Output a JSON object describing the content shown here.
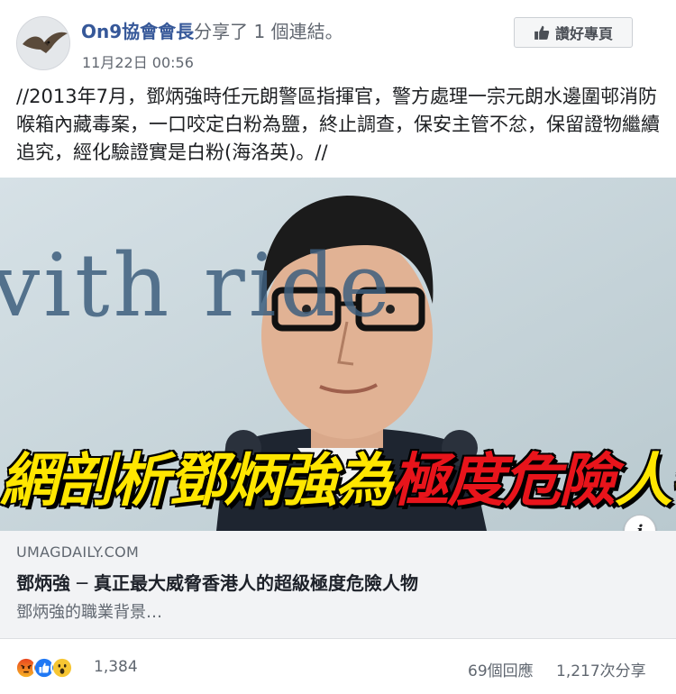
{
  "post": {
    "author": {
      "page_name": "On9協會會長",
      "shared_text": "分享了 1 個連結。",
      "timestamp": "11月22日 00:56",
      "avatar_icon": "bird-icon"
    },
    "like_page_button": {
      "label": "讚好專頁",
      "icon": "thumbs-up-icon"
    },
    "message": "//2013年7月，鄧炳強時任元朗警區指揮官，警方處理一宗元朗水邊圍邨消防喉箱內藏毒案，一口咬定白粉為鹽，終止調查，保安主管不忿，保留證物繼續追究，經化驗證實是白粉(海洛英)。//",
    "image": {
      "headline_yellow_1": "網剖析鄧炳強為",
      "headline_red": "極度危險",
      "headline_yellow_2": "人物",
      "background_text": "vith ride",
      "info_icon": "info-icon",
      "colors": {
        "yellow": "#ffe600",
        "red": "#e8141b"
      }
    },
    "link": {
      "domain": "UMAGDAILY.COM",
      "title": "鄧炳強 ─ 真正最大威脅香港人的超級極度危險人物",
      "description": "鄧炳強的職業背景…"
    },
    "footer": {
      "reaction_icons": [
        "angry-icon",
        "like-icon",
        "wow-icon"
      ],
      "reaction_count": "1,384",
      "comments": "69個回應",
      "shares": "1,217次分享"
    }
  }
}
